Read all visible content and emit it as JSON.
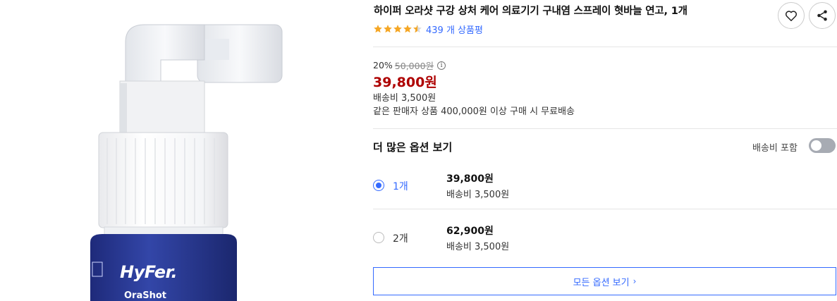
{
  "product": {
    "title": "하이퍼 오라샷 구강 상처 케어 의료기기 구내염 스프레이 혓바늘 연고, 1개",
    "image_brand": "HyFer.",
    "image_subbrand": "OraShot",
    "rating_value": 4.5,
    "review_count_text": "439 개 상품평"
  },
  "pricing": {
    "discount_rate": "20%",
    "original_price": "50,000원",
    "info_symbol": "i",
    "price": "39,800원",
    "shipping_fee": "배송비 3,500원",
    "free_shipping_note": "같은 판매자 상품 400,000원 이상 구매 시 무료배송"
  },
  "options": {
    "title": "더 많은 옵션 보기",
    "include_shipping_label": "배송비 포함",
    "include_shipping_on": false,
    "items": [
      {
        "qty": "1개",
        "price": "39,800원",
        "shipping": "배송비 3,500원",
        "selected": true
      },
      {
        "qty": "2개",
        "price": "62,900원",
        "shipping": "배송비 3,500원",
        "selected": false
      }
    ],
    "all_options_label": "모든 옵션 보기",
    "all_options_chevron": "›"
  },
  "colors": {
    "accent_blue": "#346aff",
    "price_red": "#ae0000",
    "star_orange": "#f5a623",
    "label_navy": "#2f3c8e"
  },
  "icons": [
    "heart-icon",
    "share-icon",
    "star-icon",
    "info-icon",
    "chevron-right-icon"
  ]
}
